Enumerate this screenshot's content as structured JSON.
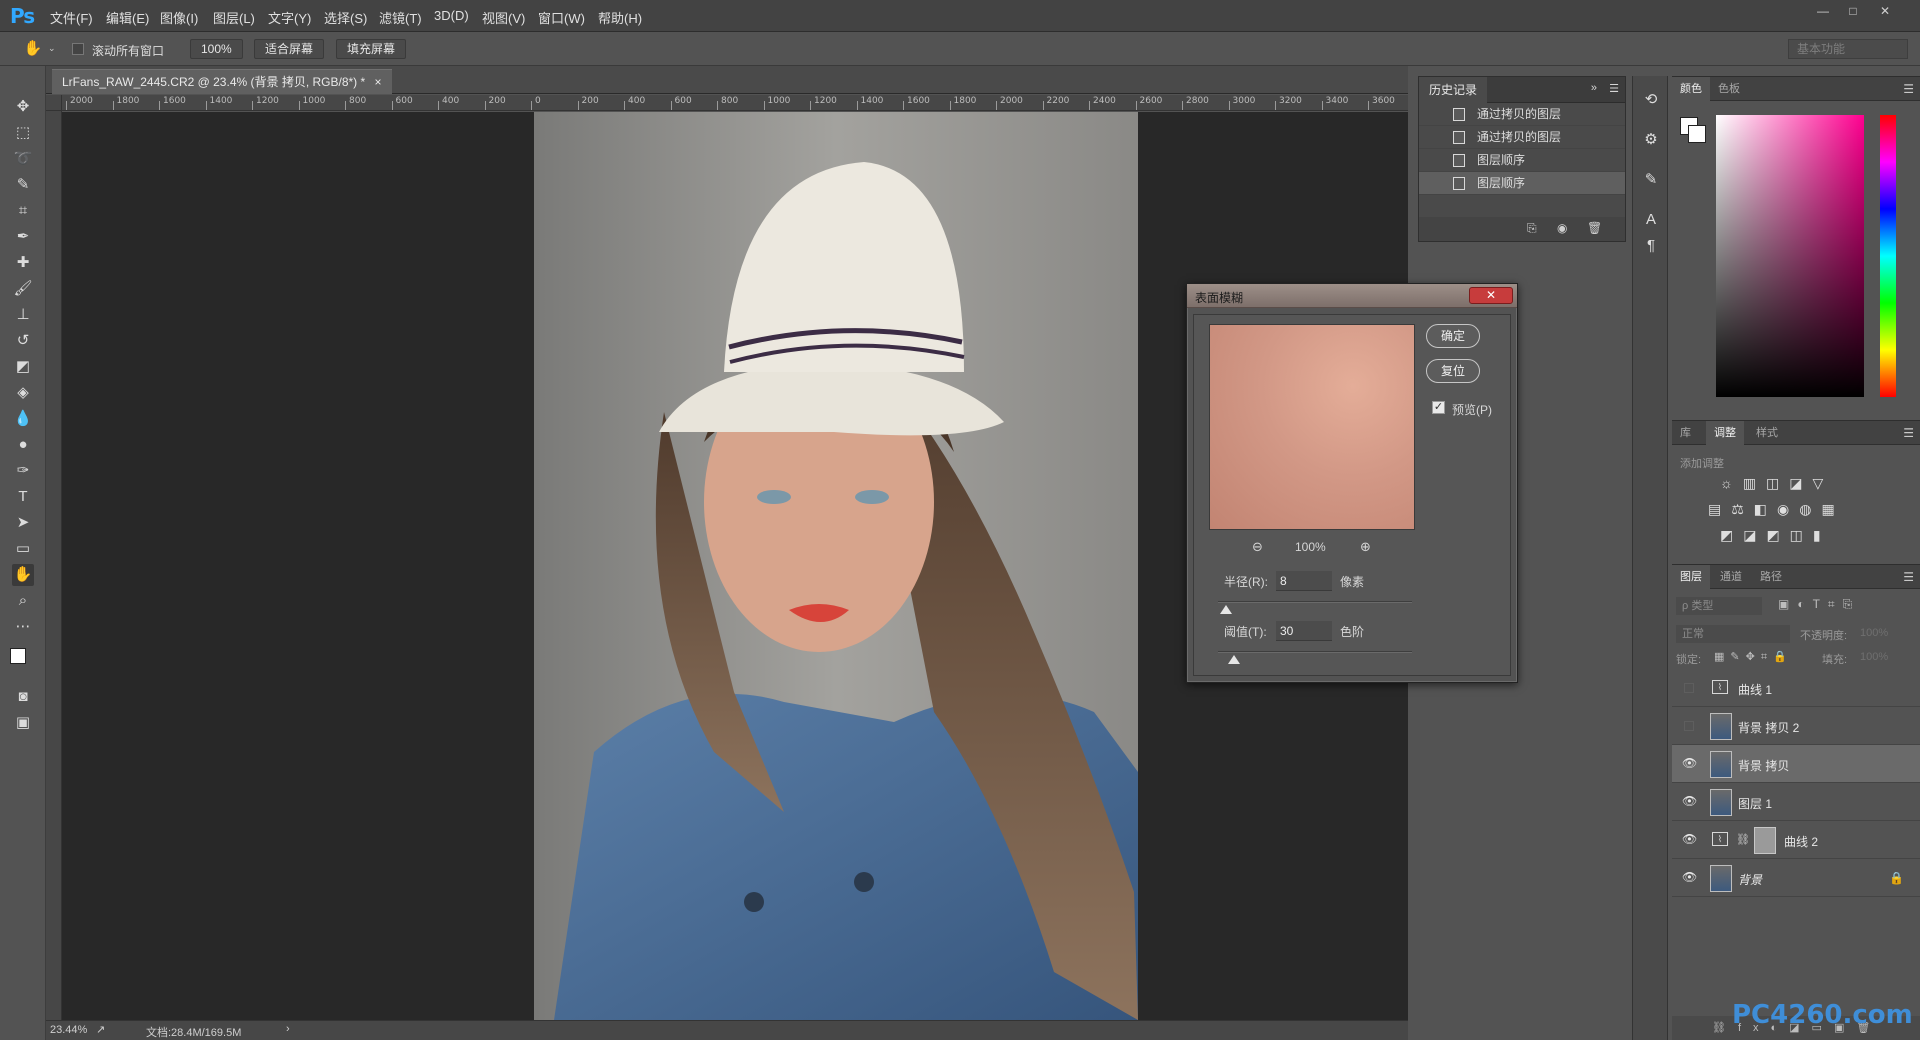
{
  "app": {
    "logo": "Ps",
    "menu": [
      "文件(F)",
      "编辑(E)",
      "图像(I)",
      "图层(L)",
      "文字(Y)",
      "选择(S)",
      "滤镜(T)",
      "3D(D)",
      "视图(V)",
      "窗口(W)",
      "帮助(H)"
    ],
    "window_controls": [
      "—",
      "□",
      "✕"
    ]
  },
  "options": {
    "scroll_all_windows": "滚动所有窗口",
    "zoom_btn": "100%",
    "fit_screen": "适合屏幕",
    "fill_screen": "填充屏幕",
    "workspace": "基本功能"
  },
  "document": {
    "tab_title": "LrFans_RAW_2445.CR2 @ 23.4% (背景 拷贝, RGB/8*) *",
    "tab_close": "×",
    "ruler_labels": [
      "2000",
      "1800",
      "1600",
      "1400",
      "1200",
      "1000",
      "800",
      "600",
      "400",
      "200",
      "0",
      "200",
      "400",
      "600",
      "800",
      "1000",
      "1200",
      "1400",
      "1600",
      "1800",
      "2000",
      "2200",
      "2400",
      "2600",
      "2800",
      "3000",
      "3200",
      "3400",
      "3600"
    ],
    "zoom": "23.44%",
    "doc_info": "文档:28.4M/169.5M"
  },
  "history": {
    "tab": "历史记录",
    "items": [
      {
        "label": "通过拷贝的图层"
      },
      {
        "label": "通过拷贝的图层"
      },
      {
        "label": "图层顺序"
      },
      {
        "label": "图层顺序"
      }
    ]
  },
  "color_panel": {
    "tabs": [
      "颜色",
      "色板"
    ]
  },
  "adjust_panel": {
    "tabs": [
      "库",
      "调整",
      "样式"
    ],
    "add_label": "添加调整"
  },
  "layers_panel": {
    "tabs": [
      "图层",
      "通道",
      "路径"
    ],
    "kind_filter": "ρ 类型",
    "blend_mode": "正常",
    "opacity_label": "不透明度:",
    "opacity_value": "100%",
    "lock_label": "锁定:",
    "fill_label": "填充:",
    "fill_value": "100%",
    "layers": [
      {
        "name": "曲线 1",
        "visible": false,
        "type": "adjustment"
      },
      {
        "name": "背景 拷贝 2",
        "visible": false,
        "type": "image"
      },
      {
        "name": "背景 拷贝",
        "visible": true,
        "type": "image",
        "selected": true
      },
      {
        "name": "图层 1",
        "visible": true,
        "type": "image"
      },
      {
        "name": "曲线 2",
        "visible": true,
        "type": "adjustment-mask"
      },
      {
        "name": "背景",
        "visible": true,
        "type": "image",
        "locked": true
      }
    ]
  },
  "dialog": {
    "title": "表面模糊",
    "close": "✕",
    "ok": "确定",
    "reset": "复位",
    "preview_label": "预览(P)",
    "preview_checked": true,
    "zoom": "100%",
    "radius_label": "半径(R):",
    "radius_value": "8",
    "radius_unit": "像素",
    "threshold_label": "阈值(T):",
    "threshold_value": "30",
    "threshold_unit": "色阶"
  },
  "watermark": "PC4260.com"
}
